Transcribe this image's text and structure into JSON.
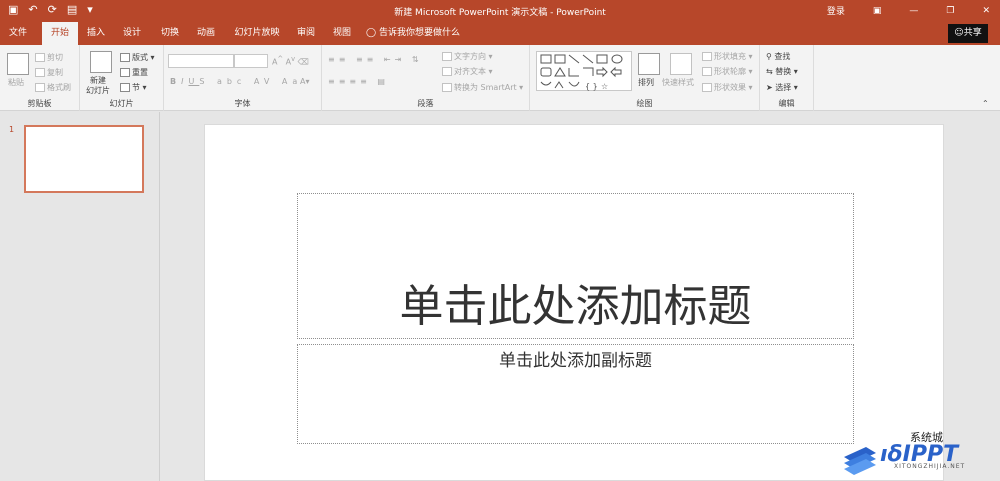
{
  "titlebar": {
    "title": "新建 Microsoft PowerPoint 演示文稿 - PowerPoint",
    "login": "登录"
  },
  "tabs": [
    {
      "label": "文件"
    },
    {
      "label": "开始"
    },
    {
      "label": "插入"
    },
    {
      "label": "设计"
    },
    {
      "label": "切换"
    },
    {
      "label": "动画"
    },
    {
      "label": "幻灯片放映"
    },
    {
      "label": "审阅"
    },
    {
      "label": "视图"
    }
  ],
  "tell_me": "告诉我你想要做什么",
  "share": "共享",
  "ribbon": {
    "clipboard": {
      "label": "剪贴板",
      "paste": "粘贴",
      "cut": "剪切",
      "copy": "复制",
      "format_painter": "格式刷"
    },
    "slides": {
      "label": "幻灯片",
      "new_slide_1": "新建",
      "new_slide_2": "幻灯片",
      "layout": "版式",
      "reset": "重置",
      "section": "节"
    },
    "font": {
      "label": "字体"
    },
    "paragraph": {
      "label": "段落",
      "text_direction": "文字方向",
      "align_text": "对齐文本",
      "smartart": "转换为 SmartArt"
    },
    "drawing": {
      "label": "绘图",
      "arrange": "排列",
      "quick_styles": "快速样式",
      "shape_fill": "形状填充",
      "shape_outline": "形状轮廓",
      "shape_effects": "形状效果"
    },
    "editing": {
      "label": "编辑",
      "find": "查找",
      "replace": "替换",
      "select": "选择"
    }
  },
  "thumbnail": {
    "number": "1"
  },
  "slide": {
    "title_placeholder": "单击此处添加标题",
    "subtitle_placeholder": "单击此处添加副标题"
  },
  "watermark": {
    "brand": "系统城",
    "url": "XITONGZHIJIA.NET"
  },
  "colors": {
    "accent": "#b7472a",
    "thumb_border": "#d4785b"
  }
}
